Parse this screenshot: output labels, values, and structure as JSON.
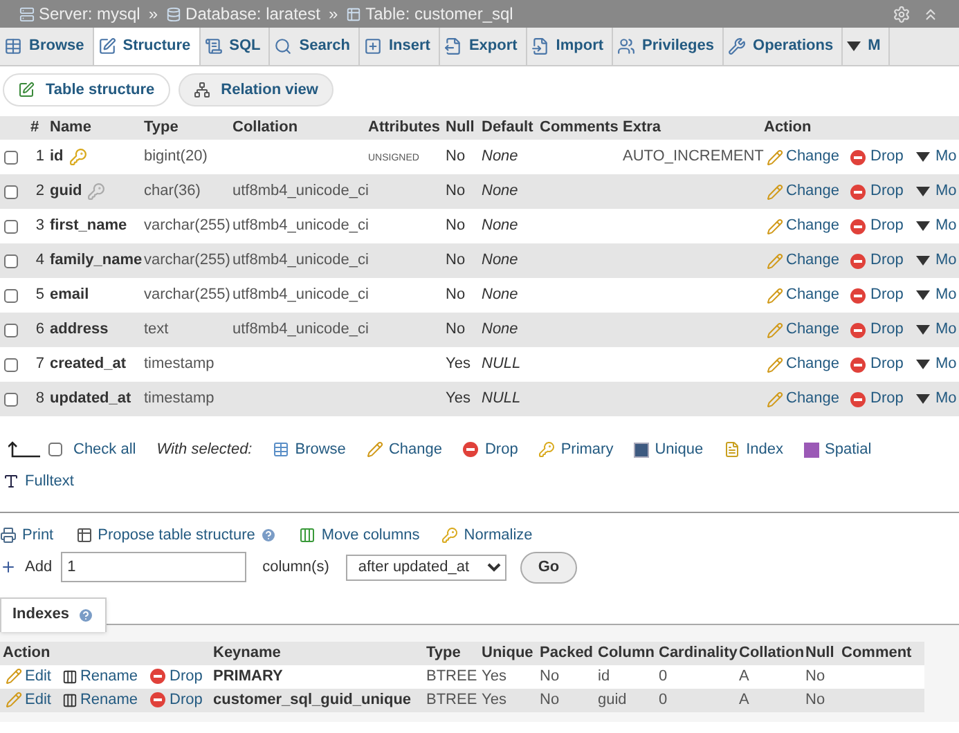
{
  "breadcrumb": {
    "separator": "»",
    "items": [
      {
        "label": "Server: mysql",
        "kind": "server"
      },
      {
        "label": "Database: laratest",
        "kind": "database"
      },
      {
        "label": "Table: customer_sql",
        "kind": "table"
      }
    ]
  },
  "tabs": [
    {
      "label": "Browse",
      "kind": "browse",
      "selected": false
    },
    {
      "label": "Structure",
      "kind": "structure",
      "selected": true
    },
    {
      "label": "SQL",
      "kind": "sql",
      "selected": false
    },
    {
      "label": "Search",
      "kind": "search",
      "selected": false
    },
    {
      "label": "Insert",
      "kind": "insert",
      "selected": false
    },
    {
      "label": "Export",
      "kind": "export",
      "selected": false
    },
    {
      "label": "Import",
      "kind": "import",
      "selected": false
    },
    {
      "label": "Privileges",
      "kind": "privileges",
      "selected": false
    },
    {
      "label": "Operations",
      "kind": "operations",
      "selected": false
    },
    {
      "label": "M",
      "kind": "more",
      "selected": false
    }
  ],
  "subtabs": [
    {
      "label": "Table structure",
      "kind": "structure",
      "selected": true
    },
    {
      "label": "Relation view",
      "kind": "relation",
      "selected": false
    }
  ],
  "columns": [
    "#",
    "Name",
    "Type",
    "Collation",
    "Attributes",
    "Null",
    "Default",
    "Comments",
    "Extra",
    "Action"
  ],
  "rows": [
    {
      "num": "1",
      "name": "id",
      "kind": "primary_key",
      "type": "bigint(20)",
      "collation": "",
      "attributes": "UNSIGNED",
      "null": "No",
      "default": "None",
      "extra": "AUTO_INCREMENT",
      "checked": false,
      "actions": [
        "Change",
        "Drop",
        "Mo"
      ]
    },
    {
      "num": "2",
      "name": "guid",
      "kind": "unique_key",
      "type": "char(36)",
      "collation": "utf8mb4_unicode_ci",
      "attributes": "",
      "null": "No",
      "default": "None",
      "extra": "",
      "checked": false,
      "actions": [
        "Change",
        "Drop",
        "Mo"
      ]
    },
    {
      "num": "3",
      "name": "first_name",
      "type": "varchar(255)",
      "collation": "utf8mb4_unicode_ci",
      "attributes": "",
      "null": "No",
      "default": "None",
      "extra": "",
      "checked": false,
      "actions": [
        "Change",
        "Drop",
        "Mo"
      ]
    },
    {
      "num": "4",
      "name": "family_name",
      "type": "varchar(255)",
      "collation": "utf8mb4_unicode_ci",
      "attributes": "",
      "null": "No",
      "default": "None",
      "extra": "",
      "checked": false,
      "actions": [
        "Change",
        "Drop",
        "Mo"
      ]
    },
    {
      "num": "5",
      "name": "email",
      "type": "varchar(255)",
      "collation": "utf8mb4_unicode_ci",
      "attributes": "",
      "null": "No",
      "default": "None",
      "extra": "",
      "checked": false,
      "actions": [
        "Change",
        "Drop",
        "Mo"
      ]
    },
    {
      "num": "6",
      "name": "address",
      "type": "text",
      "collation": "utf8mb4_unicode_ci",
      "attributes": "",
      "null": "No",
      "default": "None",
      "extra": "",
      "checked": false,
      "actions": [
        "Change",
        "Drop",
        "Mo"
      ]
    },
    {
      "num": "7",
      "name": "created_at",
      "type": "timestamp",
      "collation": "",
      "attributes": "",
      "null": "Yes",
      "default": "NULL",
      "extra": "",
      "checked": false,
      "actions": [
        "Change",
        "Drop",
        "Mo"
      ]
    },
    {
      "num": "8",
      "name": "updated_at",
      "type": "timestamp",
      "collation": "",
      "attributes": "",
      "null": "Yes",
      "default": "NULL",
      "extra": "",
      "checked": false,
      "actions": [
        "Change",
        "Drop",
        "Mo"
      ]
    }
  ],
  "bulk": {
    "check_all": {
      "label": "Check all",
      "checked": false
    },
    "with_selected": "With selected:",
    "actions": [
      {
        "label": "Browse",
        "kind": "browse"
      },
      {
        "label": "Change",
        "kind": "change"
      },
      {
        "label": "Drop",
        "kind": "drop"
      },
      {
        "label": "Primary",
        "kind": "primary"
      },
      {
        "label": "Unique",
        "kind": "unique"
      },
      {
        "label": "Index",
        "kind": "index"
      },
      {
        "label": "Spatial",
        "kind": "spatial"
      },
      {
        "label": "Fulltext",
        "kind": "fulltext"
      }
    ]
  },
  "tools": [
    {
      "label": "Print",
      "kind": "print"
    },
    {
      "label": "Propose table structure",
      "kind": "propose",
      "help": true
    },
    {
      "label": "Move columns",
      "kind": "move"
    },
    {
      "label": "Normalize",
      "kind": "normalize"
    }
  ],
  "add": {
    "label": "Add",
    "value": "1",
    "unit": "column(s)",
    "position": "after updated_at",
    "button": "Go"
  },
  "indexes": {
    "title": "Indexes",
    "columns": [
      "Action",
      "Keyname",
      "Type",
      "Unique",
      "Packed",
      "Column",
      "Cardinality",
      "Collation",
      "Null",
      "Comment"
    ],
    "rows": [
      {
        "actions": [
          "Edit",
          "Rename",
          "Drop"
        ],
        "keyname": "PRIMARY",
        "type": "BTREE",
        "unique": "Yes",
        "packed": "No",
        "column": "id",
        "cardinality": "0",
        "collation": "A",
        "null": "No",
        "comment": ""
      },
      {
        "actions": [
          "Edit",
          "Rename",
          "Drop"
        ],
        "keyname": "customer_sql_guid_unique",
        "type": "BTREE",
        "unique": "Yes",
        "packed": "No",
        "column": "guid",
        "cardinality": "0",
        "collation": "A",
        "null": "No",
        "comment": ""
      }
    ]
  }
}
